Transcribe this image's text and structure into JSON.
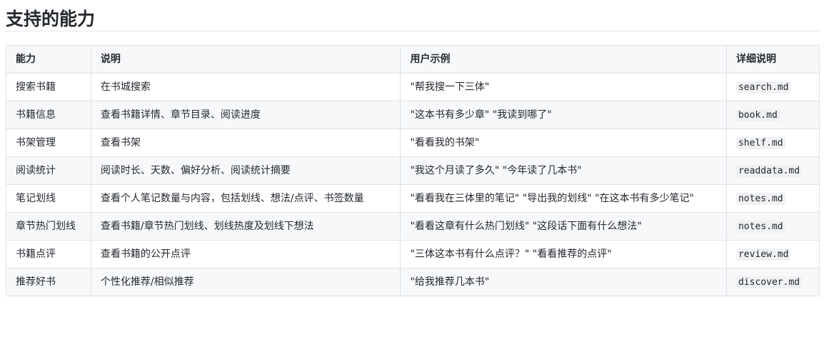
{
  "heading": "支持的能力",
  "table": {
    "headers": [
      "能力",
      "说明",
      "用户示例",
      "详细说明"
    ],
    "rows": [
      {
        "capability": "搜索书籍",
        "description": "在书城搜索",
        "example": "\"帮我搜一下三体\"",
        "doc": "search.md"
      },
      {
        "capability": "书籍信息",
        "description": "查看书籍详情、章节目录、阅读进度",
        "example": "\"这本书有多少章\" \"我读到哪了\"",
        "doc": "book.md"
      },
      {
        "capability": "书架管理",
        "description": "查看书架",
        "example": "\"看看我的书架\"",
        "doc": "shelf.md"
      },
      {
        "capability": "阅读统计",
        "description": "阅读时长、天数、偏好分析、阅读统计摘要",
        "example": "\"我这个月读了多久\" \"今年读了几本书\"",
        "doc": "readdata.md"
      },
      {
        "capability": "笔记划线",
        "description": "查看个人笔记数量与内容，包括划线、想法/点评、书签数量",
        "example": "\"看看我在三体里的笔记\" \"导出我的划线\" \"在这本书有多少笔记\"",
        "doc": "notes.md"
      },
      {
        "capability": "章节热门划线",
        "description": "查看书籍/章节热门划线、划线热度及划线下想法",
        "example": "\"看看这章有什么热门划线\" \"这段话下面有什么想法\"",
        "doc": "notes.md"
      },
      {
        "capability": "书籍点评",
        "description": "查看书籍的公开点评",
        "example": "\"三体这本书有什么点评？\" \"看看推荐的点评\"",
        "doc": "review.md"
      },
      {
        "capability": "推荐好书",
        "description": "个性化推荐/相似推荐",
        "example": "\"给我推荐几本书\"",
        "doc": "discover.md"
      }
    ]
  }
}
